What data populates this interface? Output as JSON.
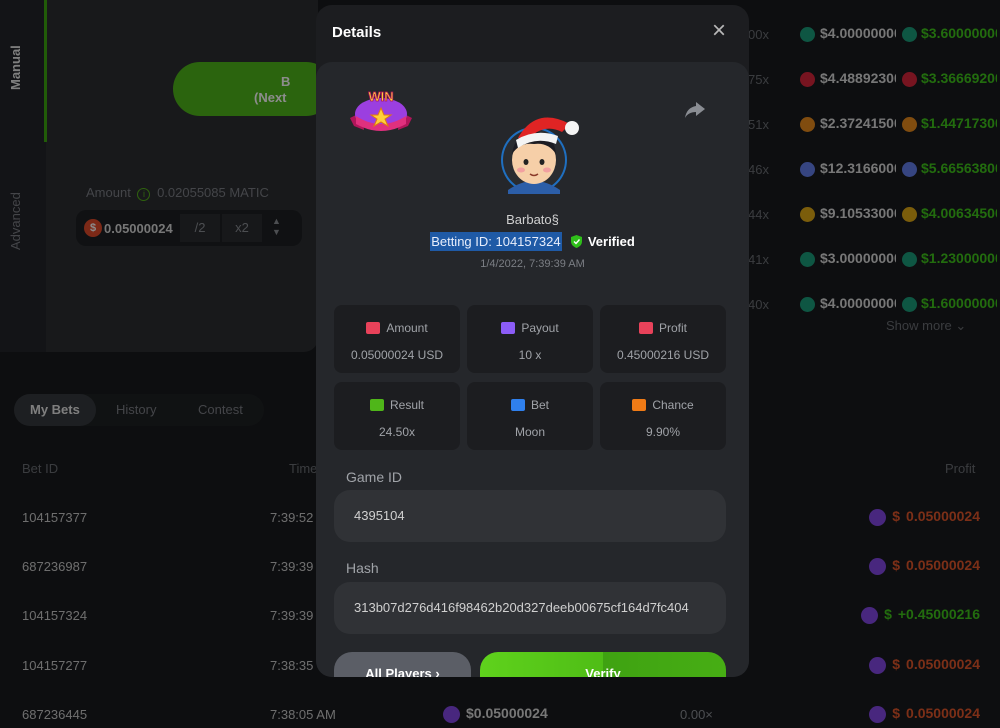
{
  "sidebar": {
    "tab_manual": "Manual",
    "tab_advanced": "Advanced",
    "bet_button": "B",
    "bet_button_sub": "(Next",
    "amount_label": "Amount",
    "amount_converted": "0.02055085 MATIC",
    "amount_value": "0.05000024",
    "half_label": "/2",
    "double_label": "x2"
  },
  "tabs": [
    "My Bets",
    "History",
    "Contest"
  ],
  "table_headers": {
    "bet_id": "Bet ID",
    "time": "Time",
    "profit": "Profit"
  },
  "my_bets": [
    {
      "bet_id": "104157377",
      "time": "7:39:52",
      "profit": "0.05000024",
      "positive": false
    },
    {
      "bet_id": "687236987",
      "time": "7:39:39",
      "profit": "0.05000024",
      "positive": false
    },
    {
      "bet_id": "104157324",
      "time": "7:39:39",
      "profit": "+0.45000216",
      "positive": true
    },
    {
      "bet_id": "104157277",
      "time": "7:38:35",
      "profit": "0.05000024",
      "positive": false
    },
    {
      "bet_id": "687236445",
      "time": "7:38:05 AM",
      "amount": "$0.05000024",
      "payout": "0.00×",
      "profit": "0.05000024",
      "positive": false
    }
  ],
  "high_bets": [
    {
      "payout": "00x",
      "bet": "$4.00000000",
      "profit": "$3.60000000",
      "coin": "#1a9c7a"
    },
    {
      "payout": "75x",
      "bet": "$4.48892300",
      "profit": "$3.36669200",
      "coin": "#d9253b"
    },
    {
      "payout": "51x",
      "bet": "$2.37241500",
      "profit": "$1.44717300",
      "coin": "#e88a1c"
    },
    {
      "payout": "46x",
      "bet": "$12.31660000",
      "profit": "$5.66563800",
      "coin": "#627eea"
    },
    {
      "payout": "44x",
      "bet": "$9.10533000",
      "profit": "$4.00634500",
      "coin": "#e0a914"
    },
    {
      "payout": "41x",
      "bet": "$3.00000000",
      "profit": "$1.23000000",
      "coin": "#1a9c7a"
    },
    {
      "payout": "40x",
      "bet": "$4.00000000",
      "profit": "$1.60000000",
      "coin": "#1a9c7a"
    }
  ],
  "show_more": "Show more",
  "modal": {
    "title": "Details",
    "win_badge": "WIN",
    "username": "Barbato§",
    "betting_id": "Betting ID: 104157324",
    "verified": "Verified",
    "datetime": "1/4/2022, 7:39:39 AM",
    "stats": [
      {
        "label": "Amount",
        "value": "0.05000024 USD",
        "icon": "coins-icon",
        "color": "#e8425a"
      },
      {
        "label": "Payout",
        "value": "10 x",
        "icon": "card-icon",
        "color": "#8b5cf6"
      },
      {
        "label": "Profit",
        "value": "0.45000216 USD",
        "icon": "profit-icon",
        "color": "#e8425a"
      },
      {
        "label": "Result",
        "value": "24.50x",
        "icon": "chart-icon",
        "color": "#4fb619"
      },
      {
        "label": "Bet",
        "value": "Moon",
        "icon": "ticket-icon",
        "color": "#2f80ed"
      },
      {
        "label": "Chance",
        "value": "9.90%",
        "icon": "percent-icon",
        "color": "#f07b16"
      }
    ],
    "game_id_label": "Game ID",
    "game_id": "4395104",
    "hash_label": "Hash",
    "hash": "313b07d276d416f98462b20d327deeb00675cf164d7fc404",
    "all_players": "All Players",
    "verify": "Verify"
  }
}
